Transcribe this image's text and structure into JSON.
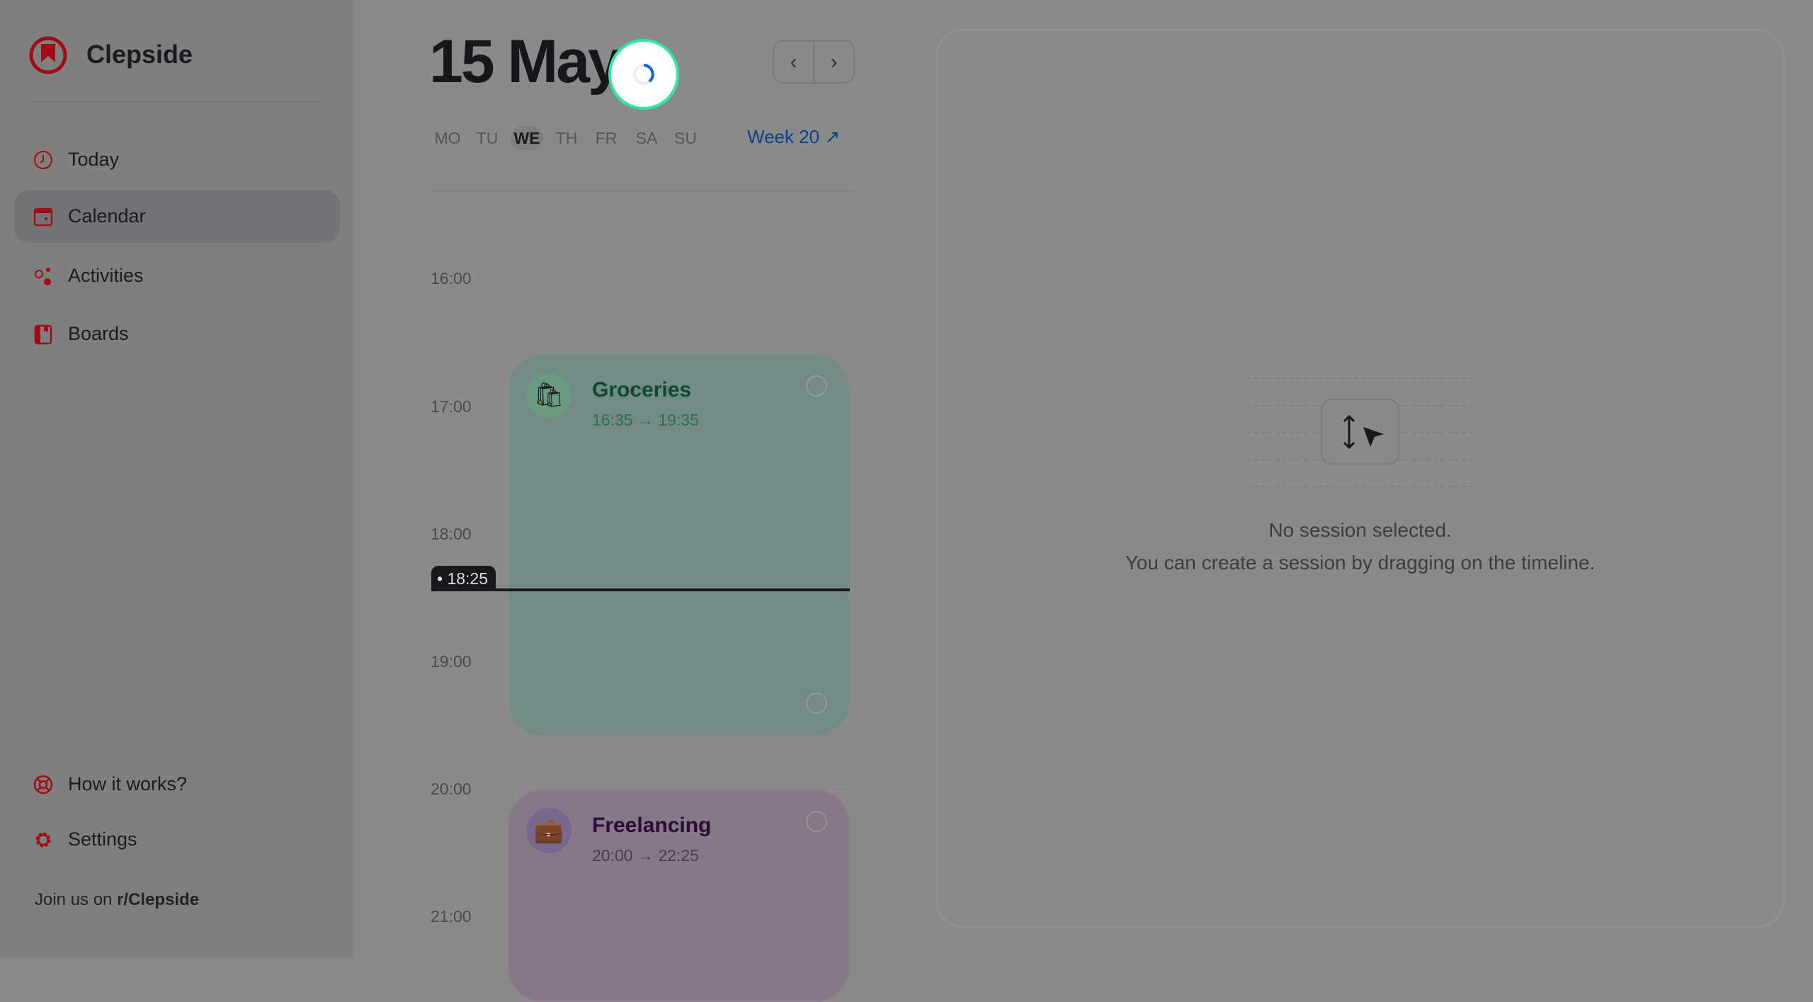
{
  "sidebar": {
    "brand": "Clepside",
    "items": [
      {
        "label": "Today",
        "icon": "clock-icon"
      },
      {
        "label": "Calendar",
        "icon": "calendar-icon",
        "selected": true
      },
      {
        "label": "Activities",
        "icon": "activities-icon"
      },
      {
        "label": "Boards",
        "icon": "board-icon"
      }
    ],
    "bottom_items": [
      {
        "label": "How it works?",
        "icon": "lifebuoy-icon"
      },
      {
        "label": "Settings",
        "icon": "gear-icon"
      }
    ],
    "join_prefix": "Join us on ",
    "join_link": "r/Clepside"
  },
  "header": {
    "title": "15 May",
    "week_link": "Week 20 ↗",
    "prev": "‹",
    "next": "›"
  },
  "weekdays": [
    {
      "label": "MO"
    },
    {
      "label": "TU"
    },
    {
      "label": "WE",
      "selected": true
    },
    {
      "label": "TH"
    },
    {
      "label": "FR"
    },
    {
      "label": "SA"
    },
    {
      "label": "SU"
    }
  ],
  "timeline": {
    "hours": [
      "16:00",
      "17:00",
      "18:00",
      "19:00",
      "20:00",
      "21:00"
    ],
    "now": "18:25",
    "sessions": [
      {
        "name": "Groceries",
        "time": "16:35 → 19:35",
        "icon": "grocery-bag-icon",
        "emoji": "🛍",
        "color": "#748a85",
        "title_color": "#0d4a35",
        "time_color": "#2a6e57"
      },
      {
        "name": "Freelancing",
        "time": "20:00 → 22:25",
        "icon": "briefcase-icon",
        "emoji": "💼",
        "color": "#877888",
        "title_color": "#2a0b3a",
        "time_color": "#4a3a55"
      }
    ]
  },
  "panel": {
    "line1": "No session selected.",
    "line2": "You can create a session by dragging on the timeline."
  },
  "colors": {
    "brand_red": "#9e0e14",
    "accent_blue": "#0c3f8c",
    "spinner_green": "#2fe8a6"
  }
}
